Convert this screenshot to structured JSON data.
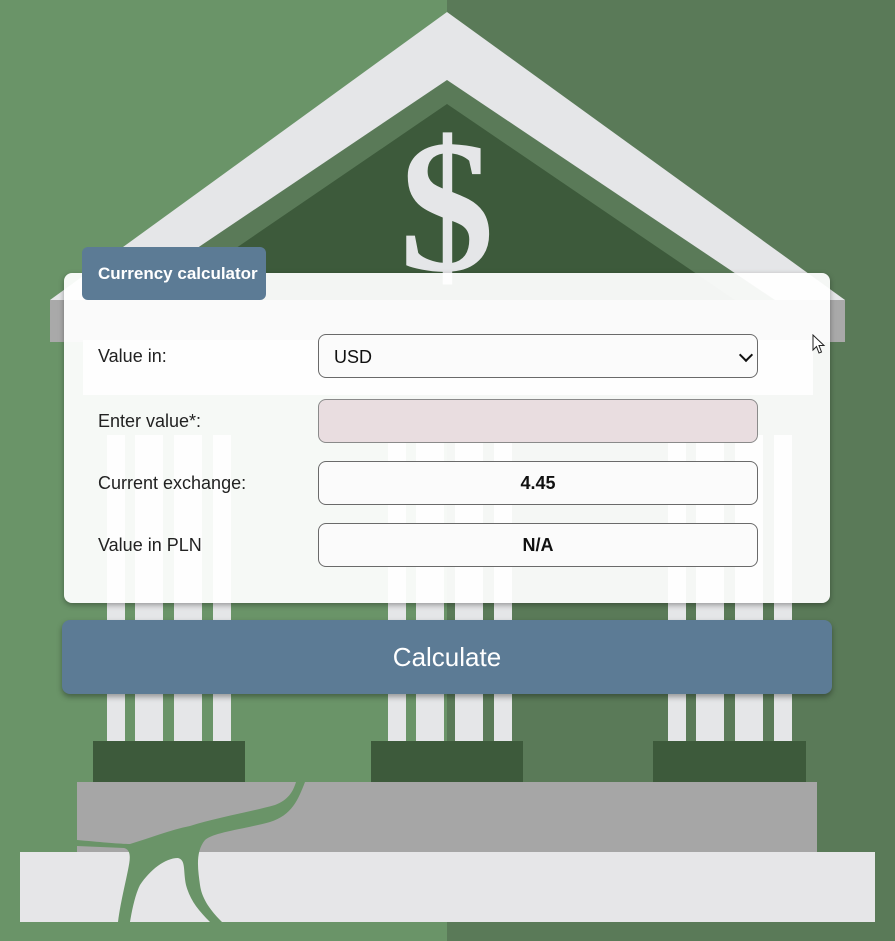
{
  "form": {
    "tab_title": "Currency calculator",
    "currency_label": "Value in:",
    "currency_value": "USD",
    "amount_label": "Enter value*:",
    "amount_value": "",
    "exchange_label": "Current exchange:",
    "exchange_value": "4.45",
    "result_label": "Value in PLN",
    "result_value": "N/A",
    "calculate_label": "Calculate"
  },
  "background": {
    "symbol": "$",
    "icons": [
      "bank-building-icon",
      "dollar-sign-icon",
      "mouse-cursor-icon",
      "chevron-down-icon"
    ]
  },
  "colors": {
    "accent": "#5c7b95",
    "bg_left": "#6a9468",
    "bg_right": "#5a7a58",
    "dark_green": "#3d5a3b"
  }
}
